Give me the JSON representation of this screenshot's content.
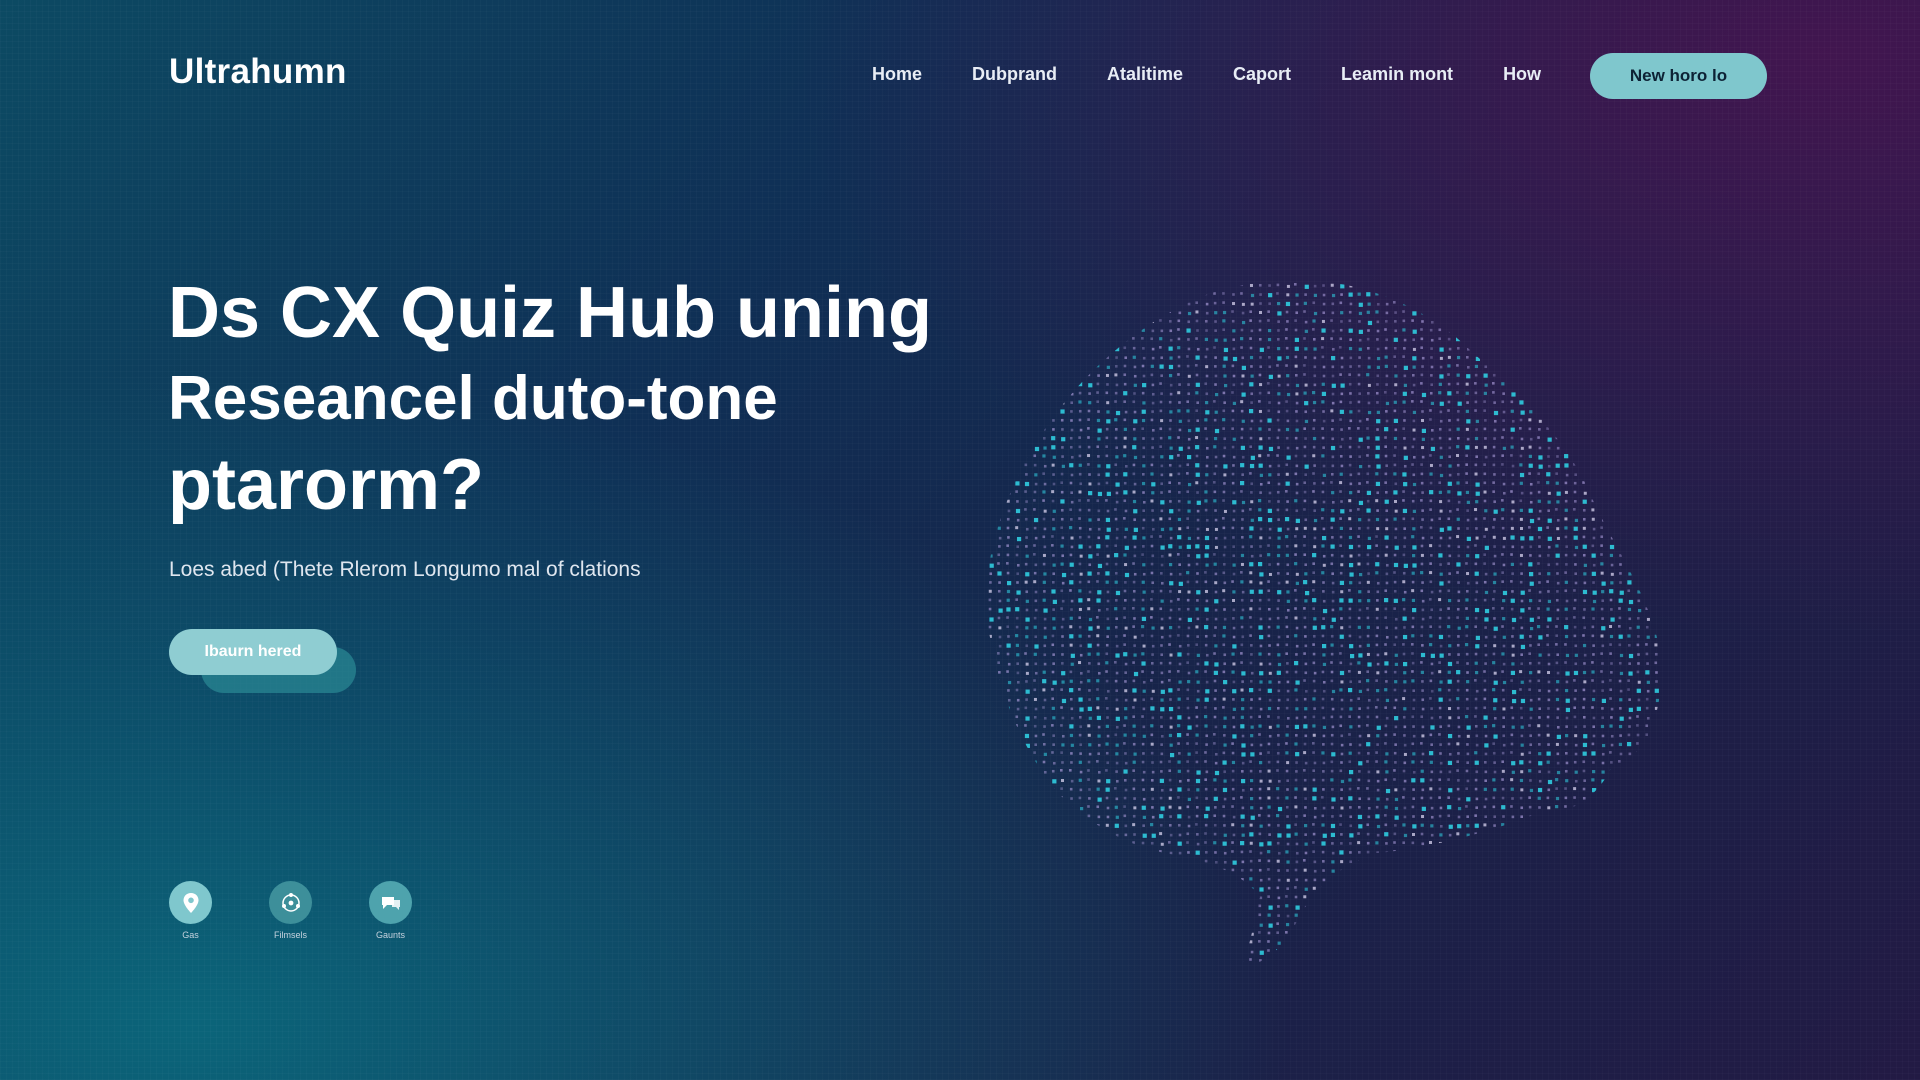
{
  "brand": {
    "name": "Ultrahumn"
  },
  "nav": {
    "items": [
      "Home",
      "Dubprand",
      "Atalitime",
      "Caport",
      "Leamin mont",
      "How"
    ],
    "cta_label": "New horo lo"
  },
  "hero": {
    "title_lines": [
      "Ds CX Quiz Hub uning",
      "Reseancel duto-tone",
      "ptarorm?"
    ],
    "subtitle": "Loes abed (Thete Rlerom Longumo mal of clations",
    "cta_label": "Ibaurn hered"
  },
  "features": [
    {
      "icon": "location-pin-icon",
      "label": "Gas"
    },
    {
      "icon": "network-icon",
      "label": "Filmsels"
    },
    {
      "icon": "chat-bubble-icon",
      "label": "Gaunts"
    }
  ],
  "colors": {
    "accent": "#7fc7cd",
    "brain_cyan": "#2ec4d8",
    "brain_violet": "#a89ad8"
  }
}
